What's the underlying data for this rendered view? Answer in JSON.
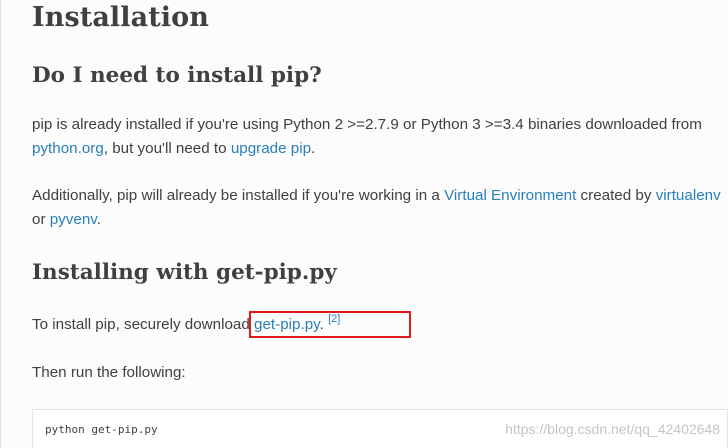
{
  "headings": {
    "title": "Installation",
    "need_pip": "Do I need to install pip?",
    "installing": "Installing with get-pip.py"
  },
  "para1": {
    "t1": "pip is already installed if you're using Python 2 >=2.7.9 or Python 3 >=3.4 binaries downloaded from ",
    "link_python_org": "python.org",
    "t2": ", but you'll need to ",
    "link_upgrade_pip": "upgrade pip",
    "t3": "."
  },
  "para2": {
    "t1": "Additionally, pip will already be installed if you're working in a ",
    "link_virtual_env": "Virtual Environment",
    "t2": " created by ",
    "link_virtualenv": "virtualenv",
    "t3": " or ",
    "link_pyvenv": "pyvenv",
    "t4": "."
  },
  "para3": {
    "t1": "To install pip, securely download ",
    "link_get_pip": "get-pip.py",
    "t2": ". ",
    "footnote": "[2]"
  },
  "para4": {
    "t1": "Then run the following:"
  },
  "code": {
    "command": "python get-pip.py"
  },
  "watermark": "https://blog.csdn.net/qq_42402648",
  "colors": {
    "link": "#2980b9",
    "text": "#404040",
    "highlight_box": "#e0191b"
  }
}
